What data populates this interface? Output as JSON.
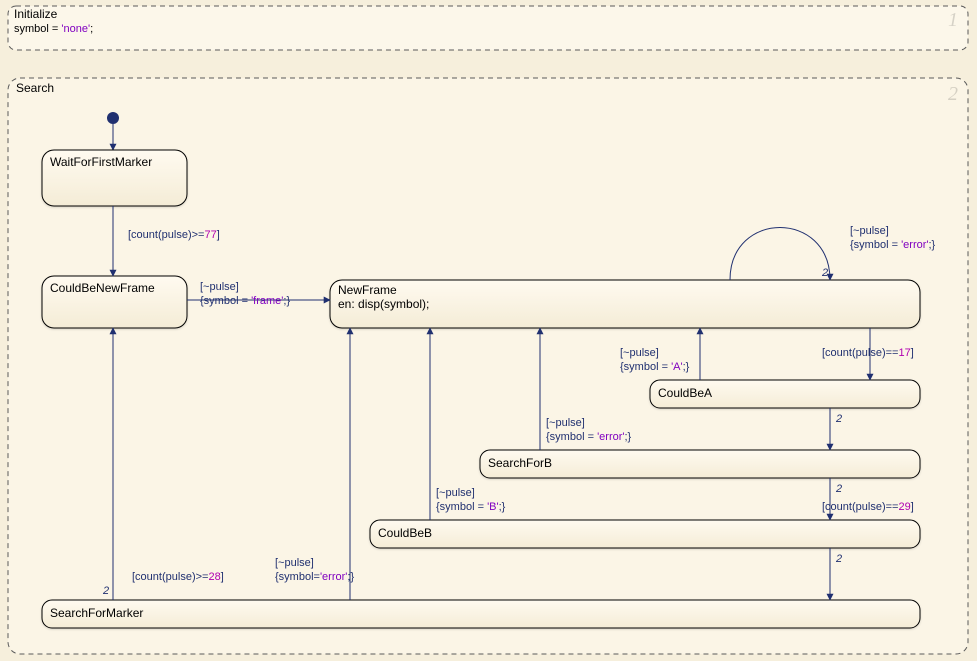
{
  "regions": {
    "initialize": {
      "title": "Initialize",
      "order": "1",
      "code_prefix": "symbol = ",
      "code_string": "'none'",
      "code_suffix": ";"
    },
    "search": {
      "title": "Search",
      "order": "2"
    }
  },
  "states": {
    "waitForFirstMarker": {
      "label": "WaitForFirstMarker"
    },
    "couldBeNewFrame": {
      "label": "CouldBeNewFrame"
    },
    "newFrame": {
      "label": "NewFrame",
      "entry": "en: disp(symbol);"
    },
    "couldBeA": {
      "label": "CouldBeA"
    },
    "searchForB": {
      "label": "SearchForB"
    },
    "couldBeB": {
      "label": "CouldBeB"
    },
    "searchForMarker": {
      "label": "SearchForMarker"
    }
  },
  "transitions": {
    "wffm_to_cbnf": {
      "guard_pre": "[count(",
      "guard_fn": "pulse",
      "guard_mid": ")>=",
      "guard_num": "77",
      "guard_post": "]"
    },
    "cbnf_to_nf": {
      "event": "[~pulse]",
      "action_pre": "{symbol = ",
      "action_str": "'frame'",
      "action_post": ";}"
    },
    "nf_self": {
      "event": "[~pulse]",
      "action_pre": "{symbol = ",
      "action_str": "'error'",
      "action_post": ";}",
      "priority": "2"
    },
    "nf_to_cba": {
      "guard_pre": "[count(",
      "guard_fn": "pulse",
      "guard_mid": ")==",
      "guard_num": "17",
      "guard_post": "]"
    },
    "cba_to_nf": {
      "event": "[~pulse]",
      "action_pre": "{symbol = ",
      "action_str": "'A'",
      "action_post": ";}"
    },
    "cba_to_sfb": {
      "priority": "2"
    },
    "sfb_to_nf": {
      "event": "[~pulse]",
      "action_pre": "{symbol = ",
      "action_str": "'error'",
      "action_post": ";}"
    },
    "sfb_to_cbb": {
      "guard_pre": "[count(",
      "guard_fn": "pulse",
      "guard_mid": ")==",
      "guard_num": "29",
      "guard_post": "]",
      "priority": "2"
    },
    "cbb_to_nf": {
      "event": "[~pulse]",
      "action_pre": "{symbol = ",
      "action_str": "'B'",
      "action_post": ";}"
    },
    "cbb_to_sfm": {
      "priority": "2"
    },
    "sfm_to_nf": {
      "event": "[~pulse]",
      "action_pre": "{symbol=",
      "action_str": "'error'",
      "action_post": ";}"
    },
    "sfm_to_cbnf": {
      "guard_pre": "[count(",
      "guard_fn": "pulse",
      "guard_mid": ")>=",
      "guard_num": "28",
      "guard_post": "]",
      "priority": "2"
    }
  },
  "chart_data": {
    "type": "diagram",
    "kind": "stateflow-chart",
    "regions": [
      "Initialize",
      "Search"
    ],
    "initialize_action": "symbol = 'none';",
    "states": [
      "WaitForFirstMarker",
      "CouldBeNewFrame",
      "NewFrame",
      "CouldBeA",
      "SearchForB",
      "CouldBeB",
      "SearchForMarker"
    ],
    "initial_state": "WaitForFirstMarker",
    "state_entry_actions": {
      "NewFrame": "disp(symbol);"
    },
    "transitions": [
      {
        "from": "WaitForFirstMarker",
        "to": "CouldBeNewFrame",
        "guard": "count(pulse)>=77"
      },
      {
        "from": "CouldBeNewFrame",
        "to": "NewFrame",
        "event": "~pulse",
        "action": "symbol = 'frame';"
      },
      {
        "from": "NewFrame",
        "to": "NewFrame",
        "event": "~pulse",
        "action": "symbol = 'error';",
        "priority": 2
      },
      {
        "from": "NewFrame",
        "to": "CouldBeA",
        "guard": "count(pulse)==17"
      },
      {
        "from": "CouldBeA",
        "to": "NewFrame",
        "event": "~pulse",
        "action": "symbol = 'A';"
      },
      {
        "from": "CouldBeA",
        "to": "SearchForB",
        "priority": 2
      },
      {
        "from": "SearchForB",
        "to": "NewFrame",
        "event": "~pulse",
        "action": "symbol = 'error';"
      },
      {
        "from": "SearchForB",
        "to": "CouldBeB",
        "guard": "count(pulse)==29",
        "priority": 2
      },
      {
        "from": "CouldBeB",
        "to": "NewFrame",
        "event": "~pulse",
        "action": "symbol = 'B';"
      },
      {
        "from": "CouldBeB",
        "to": "SearchForMarker",
        "priority": 2
      },
      {
        "from": "SearchForMarker",
        "to": "NewFrame",
        "event": "~pulse",
        "action": "symbol='error';"
      },
      {
        "from": "SearchForMarker",
        "to": "CouldBeNewFrame",
        "guard": "count(pulse)>=28",
        "priority": 2
      }
    ]
  }
}
